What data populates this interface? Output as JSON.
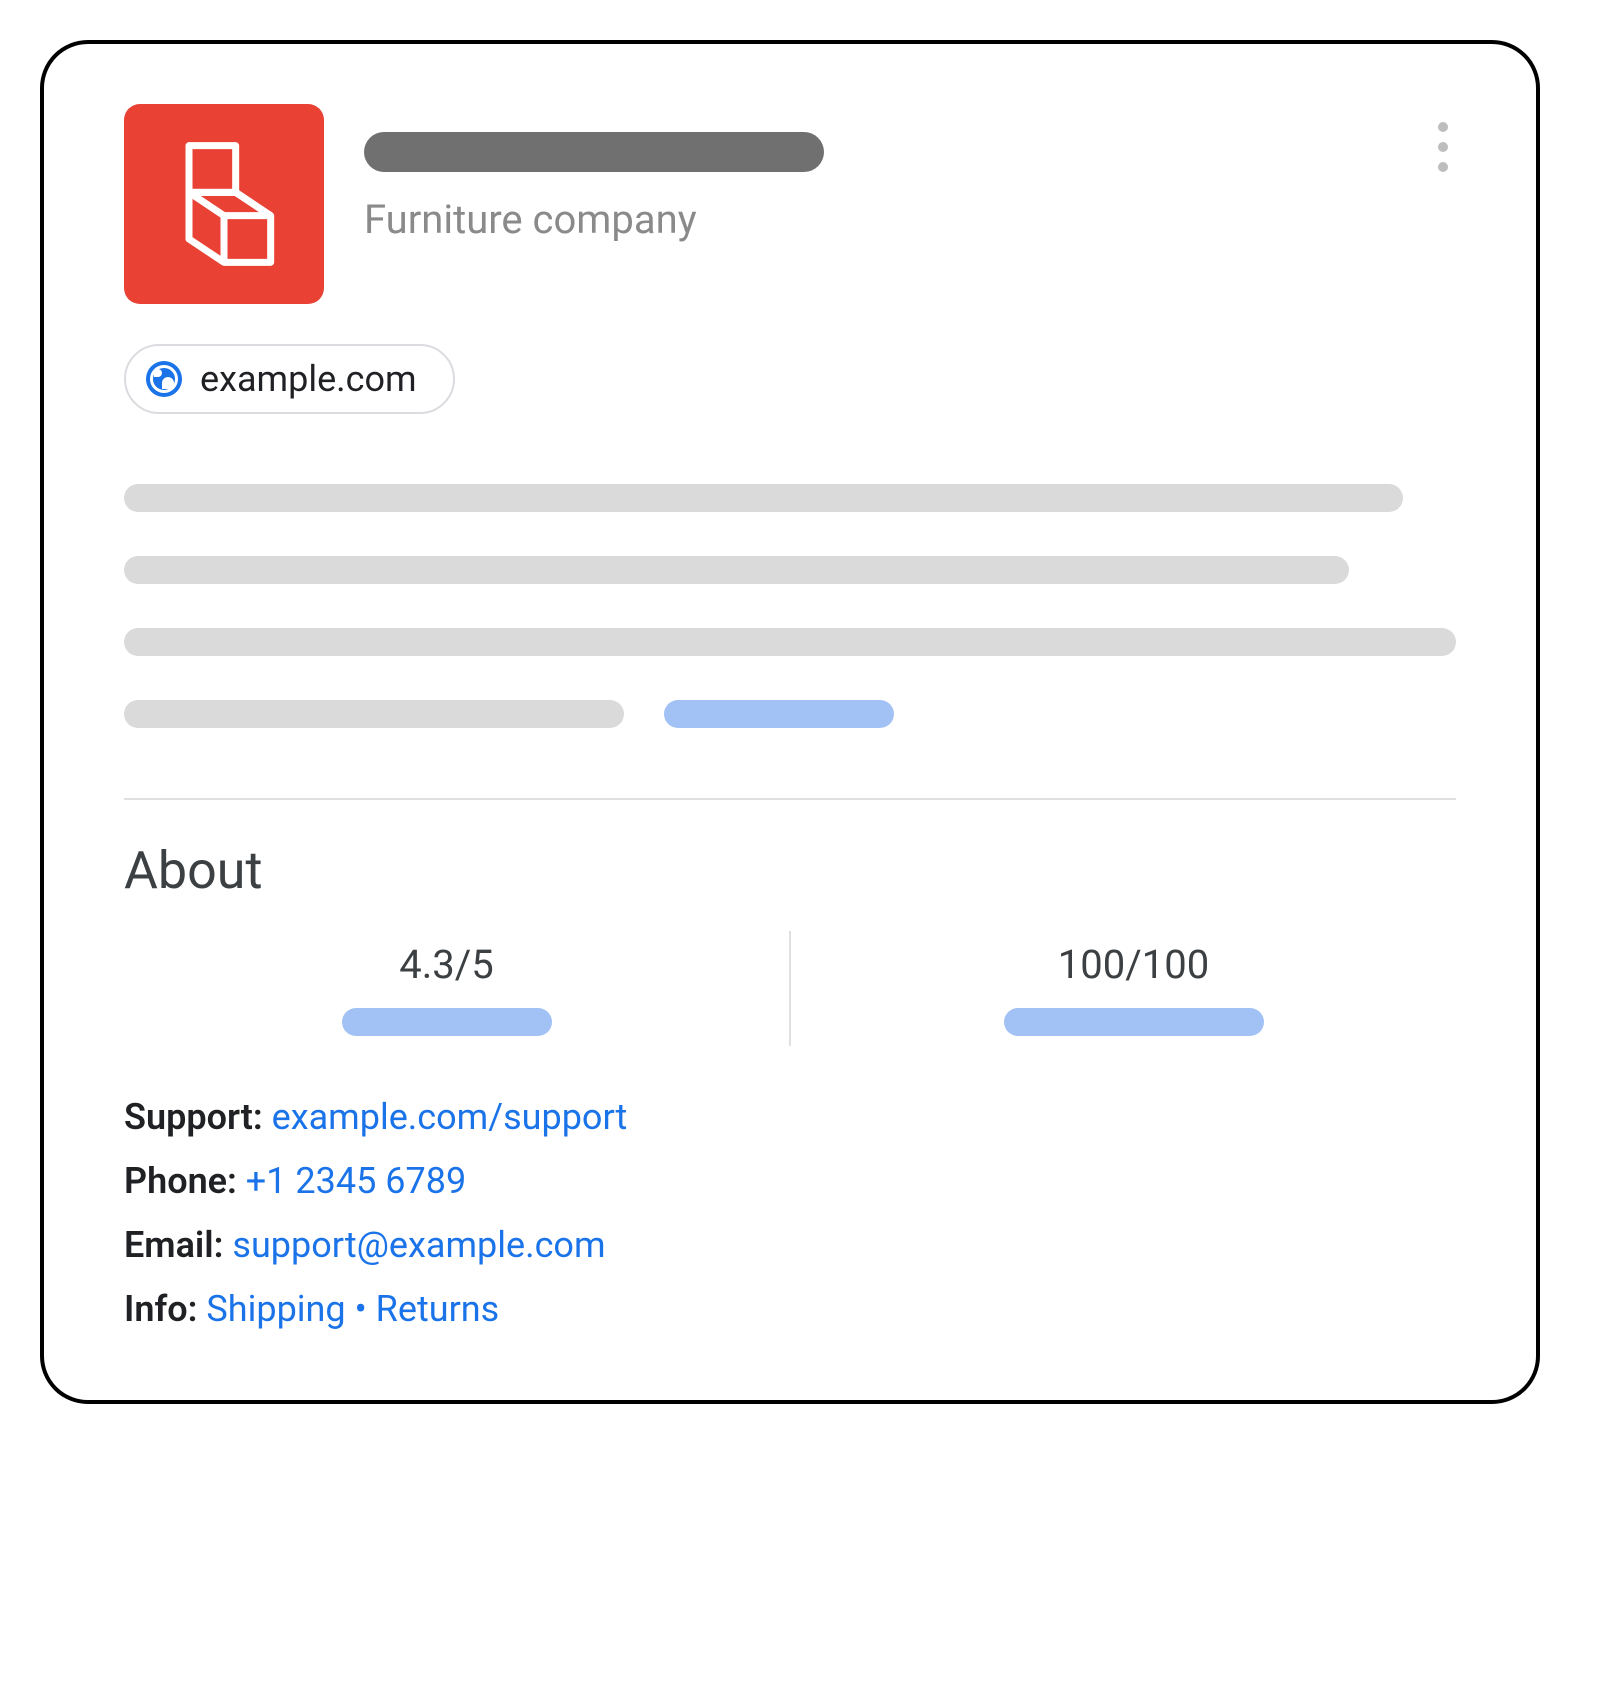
{
  "header": {
    "subtitle": "Furniture company",
    "website_chip": "example.com"
  },
  "about": {
    "heading": "About",
    "score_left": "4.3/5",
    "score_right": "100/100"
  },
  "contacts": {
    "support": {
      "label": "Support:",
      "value": "example.com/support"
    },
    "phone": {
      "label": "Phone:",
      "value": "+1 2345 6789"
    },
    "email": {
      "label": "Email:",
      "value": "support@example.com"
    },
    "info": {
      "label": "Info:",
      "link1": "Shipping",
      "sep": "•",
      "link2": "Returns"
    }
  }
}
